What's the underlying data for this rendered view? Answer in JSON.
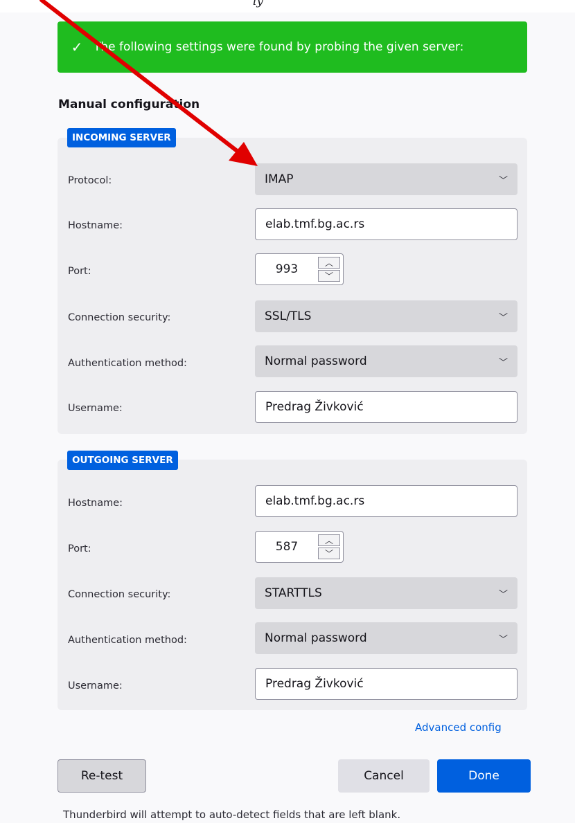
{
  "top_strip_text": "ly",
  "notice": {
    "icon": "check-icon",
    "text": "The following settings were found by probing the given server:",
    "color": "#1fbc1f"
  },
  "section_title": "Manual configuration",
  "incoming": {
    "badge": "INCOMING SERVER",
    "protocol_label": "Protocol:",
    "protocol_value": "IMAP",
    "hostname_label": "Hostname:",
    "hostname_value": "elab.tmf.bg.ac.rs",
    "port_label": "Port:",
    "port_value": "993",
    "security_label": "Connection security:",
    "security_value": "SSL/TLS",
    "auth_label": "Authentication method:",
    "auth_value": "Normal password",
    "username_label": "Username:",
    "username_value": "Predrag Živković"
  },
  "outgoing": {
    "badge": "OUTGOING SERVER",
    "hostname_label": "Hostname:",
    "hostname_value": "elab.tmf.bg.ac.rs",
    "port_label": "Port:",
    "port_value": "587",
    "security_label": "Connection security:",
    "security_value": "STARTTLS",
    "auth_label": "Authentication method:",
    "auth_value": "Normal password",
    "username_label": "Username:",
    "username_value": "Predrag Živković"
  },
  "advanced_link": "Advanced config",
  "buttons": {
    "retest": "Re-test",
    "cancel": "Cancel",
    "done": "Done"
  },
  "footnote": "Thunderbird will attempt to auto-detect fields that are left blank.",
  "colors": {
    "accent": "#0060df",
    "annotation_arrow": "#e00000"
  }
}
